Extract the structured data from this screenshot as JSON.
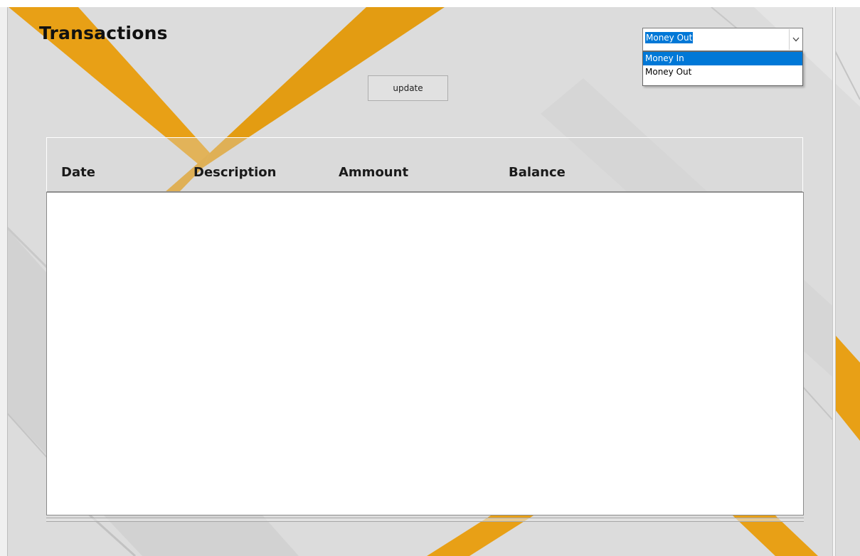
{
  "page": {
    "title": "Transactions"
  },
  "toolbar": {
    "update_label": "update"
  },
  "filter": {
    "selected": "Money Out",
    "options": [
      "Money In",
      "Money Out"
    ],
    "highlighted_option": "Money In"
  },
  "table": {
    "columns": [
      "Date",
      "Description",
      "Ammount",
      "Balance"
    ],
    "rows": []
  },
  "icons": {
    "dropdown": "chevron-down-icon"
  },
  "colors": {
    "accent": "#e8a016",
    "selection": "#0078d7",
    "background": "#dcdcdc"
  }
}
